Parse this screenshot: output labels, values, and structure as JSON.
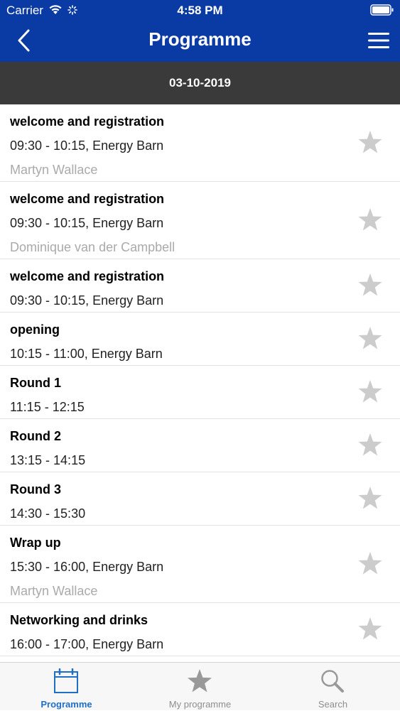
{
  "status_bar": {
    "carrier": "Carrier",
    "time": "4:58 PM"
  },
  "header": {
    "title": "Programme"
  },
  "date": "03-10-2019",
  "sessions": [
    {
      "title": "welcome and registration",
      "time": "09:30 - 10:15, Energy Barn",
      "speaker": "Martyn Wallace"
    },
    {
      "title": "welcome and registration",
      "time": "09:30 - 10:15, Energy Barn",
      "speaker": "Dominique van der Campbell"
    },
    {
      "title": "welcome and registration",
      "time": "09:30 - 10:15, Energy Barn",
      "speaker": ""
    },
    {
      "title": "opening",
      "time": "10:15 - 11:00, Energy Barn",
      "speaker": ""
    },
    {
      "title": "Round 1",
      "time": "11:15 - 12:15",
      "speaker": ""
    },
    {
      "title": "Round 2",
      "time": "13:15 - 14:15",
      "speaker": ""
    },
    {
      "title": "Round 3",
      "time": "14:30 - 15:30",
      "speaker": ""
    },
    {
      "title": "Wrap up",
      "time": "15:30 - 16:00, Energy Barn",
      "speaker": "Martyn Wallace"
    },
    {
      "title": "Networking and drinks",
      "time": "16:00 - 17:00, Energy Barn",
      "speaker": ""
    }
  ],
  "tabs": [
    {
      "label": "Programme",
      "icon": "calendar-icon"
    },
    {
      "label": "My programme",
      "icon": "star-icon"
    },
    {
      "label": "Search",
      "icon": "search-icon"
    }
  ],
  "colors": {
    "header_bg": "#0a3aa3",
    "date_bar_bg": "#3a3a3a",
    "active_tab": "#1f6fc5",
    "inactive_icon": "#999999",
    "star": "#cccccc"
  }
}
